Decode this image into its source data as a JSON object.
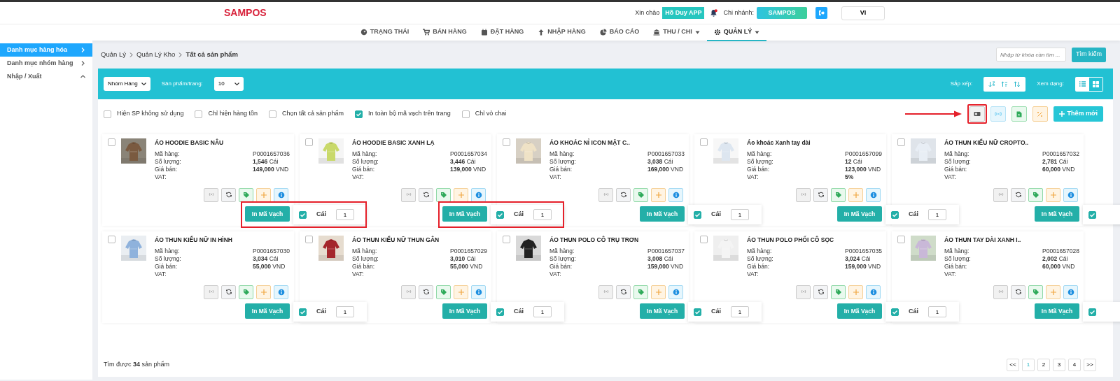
{
  "header": {
    "logo": "SAMPOS",
    "greeting": "Xin chào",
    "user": "Hồ Duy APP",
    "branch_label": "Chi nhánh:",
    "branch": "SAMPOS",
    "language": "VI",
    "notification": true
  },
  "nav": [
    {
      "label": "TRẠNG THÁI",
      "dropdown": false,
      "selected": false
    },
    {
      "label": "BÁN HÀNG",
      "dropdown": false,
      "selected": false
    },
    {
      "label": "ĐẶT HÀNG",
      "dropdown": false,
      "selected": false
    },
    {
      "label": "NHẬP HÀNG",
      "dropdown": false,
      "selected": false
    },
    {
      "label": "BÁO CÁO",
      "dropdown": false,
      "selected": false
    },
    {
      "label": "THU / CHI",
      "dropdown": true,
      "selected": false
    },
    {
      "label": "QUẢN LÝ",
      "dropdown": true,
      "selected": true
    }
  ],
  "sidebar": {
    "items": [
      {
        "label": "Danh mục hàng hóa",
        "selected": true,
        "expanded": false
      },
      {
        "label": "Danh mục nhóm hàng",
        "selected": false,
        "expanded": false
      },
      {
        "label": "Nhập / Xuất",
        "selected": false,
        "expanded": true
      }
    ]
  },
  "breadcrumb": [
    "Quản Lý",
    "Quản Lý Kho",
    "Tất cả sản phẩm"
  ],
  "search": {
    "placeholder": "Nhập từ khóa cần tìm ...",
    "button": "Tìm kiếm"
  },
  "filter_bar": {
    "group_select": "Nhóm Hàng",
    "per_page_label": "Sản phẩm/trang:",
    "per_page": "10",
    "sort_label": "Sắp xếp:",
    "view_label": "Xem dạng:",
    "views": [
      {
        "kind": "list",
        "selected": false
      },
      {
        "kind": "grid",
        "selected": true
      }
    ]
  },
  "options": [
    {
      "label": "Hiện SP không sử dụng",
      "checked": false
    },
    {
      "label": "Chỉ hiện hàng tồn",
      "checked": false
    },
    {
      "label": "Chọn tất cả sản phẩm",
      "checked": false
    },
    {
      "label": "In toàn bộ mã vạch trên trang",
      "checked": true
    },
    {
      "label": "Chỉ vỏ chai",
      "checked": false
    }
  ],
  "toolbar": [
    {
      "kind": "barcode",
      "highlighted": true
    },
    {
      "kind": "rfid",
      "highlighted": false
    },
    {
      "kind": "excel",
      "highlighted": false
    },
    {
      "kind": "percent",
      "highlighted": false
    },
    {
      "kind": "add",
      "label": "Thêm mới",
      "highlighted": false
    }
  ],
  "products": [
    {
      "name": "ÁO HOODIE BASIC NÂU",
      "fields": [
        [
          "Mã hàng:",
          "P0001657036"
        ],
        [
          "Số lượng:",
          "**1,546** Cái"
        ],
        [
          "Giá bán:",
          "**149,000** VND"
        ],
        [
          "VAT:"
        ]
      ],
      "checked": false,
      "print": "In Mã Vạch",
      "print_checked": true,
      "unit": "Cái",
      "count": "1",
      "highlighted": true
    },
    {
      "name": "ÁO HOODIE BASIC XANH LẠ",
      "fields": [
        [
          "Mã hàng:",
          "P0001657034"
        ],
        [
          "Số lượng:",
          "**3,446** Cái"
        ],
        [
          "Giá bán:",
          "**139,000** VND"
        ],
        [
          "VAT:"
        ]
      ],
      "checked": false,
      "print": "In Mã Vạch",
      "print_checked": true,
      "unit": "Cái",
      "count": "1",
      "highlighted": true
    },
    {
      "name": "ÁO KHOÁC NỈ ICON MẶT C..",
      "fields": [
        [
          "Mã hàng:",
          "P0001657033"
        ],
        [
          "Số lượng:",
          "**3,038** Cái"
        ],
        [
          "Giá bán:",
          "**169,000** VND"
        ],
        [
          "VAT:"
        ]
      ],
      "checked": false,
      "print": "In Mã Vạch",
      "print_checked": true,
      "unit": "Cái",
      "count": "1",
      "highlighted": false
    },
    {
      "name": "Áo khoác Xanh tay dài",
      "fields": [
        [
          "Mã hàng:",
          "P0001657099"
        ],
        [
          "Số lượng:",
          "**12** Cái"
        ],
        [
          "Giá bán:",
          "**123,000** VND"
        ],
        [
          "VAT:",
          "**5%**"
        ]
      ],
      "checked": false,
      "print": "In Mã Vạch",
      "print_checked": true,
      "unit": "Cái",
      "count": "1",
      "highlighted": false
    },
    {
      "name": "ÁO THUN KIỂU NỮ CROPTO..",
      "fields": [
        [
          "Mã hàng:",
          "P0001657032"
        ],
        [
          "Số lượng:",
          "**2,781** Cái"
        ],
        [
          "Giá bán:",
          "**60,000** VND"
        ],
        [
          "VAT:"
        ]
      ],
      "checked": false,
      "print": "In Mã Vạch",
      "print_checked": true,
      "highlighted": false
    },
    {
      "name": "ÁO THUN KIỂU NỮ IN HÌNH",
      "fields": [
        [
          "Mã hàng:",
          "P0001657030"
        ],
        [
          "Số lượng:",
          "**3,034** Cái"
        ],
        [
          "Giá bán:",
          "**55,000** VND"
        ],
        [
          "VAT:"
        ]
      ],
      "checked": false,
      "print": "In Mã Vạch",
      "print_checked": true,
      "unit": "Cái",
      "count": "1",
      "highlighted": false
    },
    {
      "name": "ÁO THUN KIỂU NỮ THUN GÂN",
      "fields": [
        [
          "Mã hàng:",
          "P0001657029"
        ],
        [
          "Số lượng:",
          "**3,010** Cái"
        ],
        [
          "Giá bán:",
          "**55,000** VND"
        ],
        [
          "VAT:"
        ]
      ],
      "checked": false,
      "print": "In Mã Vạch",
      "print_checked": true,
      "unit": "Cái",
      "count": "1",
      "highlighted": false
    },
    {
      "name": "ÁO THUN POLO CÔ TRỤ TRƠN",
      "fields": [
        [
          "Mã hàng:",
          "P0001657037"
        ],
        [
          "Số lượng:",
          "**3,008** Cái"
        ],
        [
          "Giá bán:",
          "**159,000** VND"
        ],
        [
          "VAT:"
        ]
      ],
      "checked": false,
      "print": "In Mã Vạch",
      "print_checked": true,
      "unit": "Cái",
      "count": "1",
      "highlighted": false
    },
    {
      "name": "ÁO THUN POLO PHỐI CÔ SỌC",
      "fields": [
        [
          "Mã hàng:",
          "P0001657035"
        ],
        [
          "Số lượng:",
          "**3,024** Cái"
        ],
        [
          "Giá bán:",
          "**159,000** VND"
        ],
        [
          "VAT:"
        ]
      ],
      "checked": false,
      "print": "In Mã Vạch",
      "print_checked": true,
      "unit": "Cái",
      "count": "1",
      "highlighted": false
    },
    {
      "name": "ÁO THUN TAY DÀI XANH I..",
      "fields": [
        [
          "Mã hàng:",
          "P0001657028"
        ],
        [
          "Số lượng:",
          "**2,002** Cái"
        ],
        [
          "Giá bán:",
          "**60,000** VND"
        ],
        [
          "VAT:"
        ]
      ],
      "checked": false,
      "print": "In Mã Vạch",
      "print_checked": true,
      "highlighted": false
    }
  ],
  "footer": {
    "result": "Tìm được **34** sản phẩm"
  },
  "pagination": [
    {
      "label": "<<",
      "selected": false
    },
    {
      "label": "1",
      "selected": true
    },
    {
      "label": "2",
      "selected": false
    },
    {
      "label": "3",
      "selected": false
    },
    {
      "label": "4",
      "selected": false
    },
    {
      "label": ">>",
      "selected": false
    }
  ]
}
